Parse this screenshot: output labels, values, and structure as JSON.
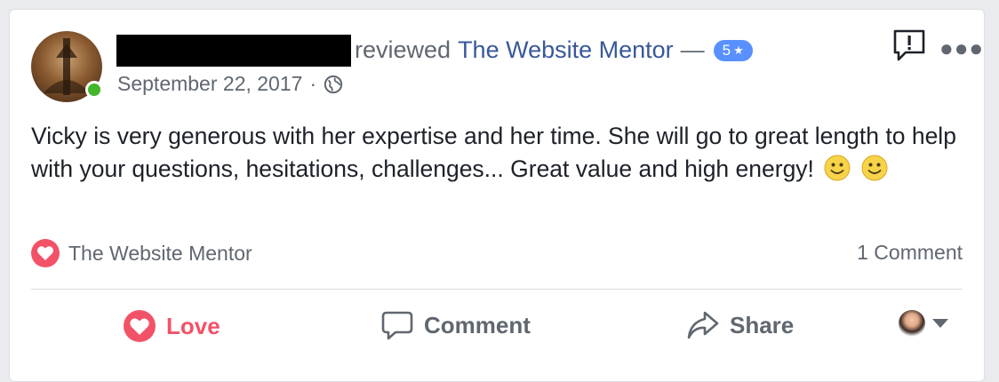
{
  "post": {
    "action_text": "reviewed",
    "page_name": "The Website Mentor",
    "separator": "—",
    "rating": "5",
    "rating_star": "★",
    "date": "September 22, 2017",
    "date_separator": "·",
    "review_text": "Vicky is very generous with her expertise and her time. She will go to great length to help with your questions, hesitations, challenges... Great value and high energy!",
    "emojis": [
      "smile-emoji",
      "smile-emoji"
    ]
  },
  "reactions": {
    "reactor_name": "The Website Mentor",
    "comment_count": "1 Comment"
  },
  "actions": {
    "love_label": "Love",
    "comment_label": "Comment",
    "share_label": "Share"
  },
  "colors": {
    "link": "#385898",
    "love": "#f25268",
    "badge": "#5890ff",
    "online": "#42b72a",
    "muted": "#606770"
  }
}
